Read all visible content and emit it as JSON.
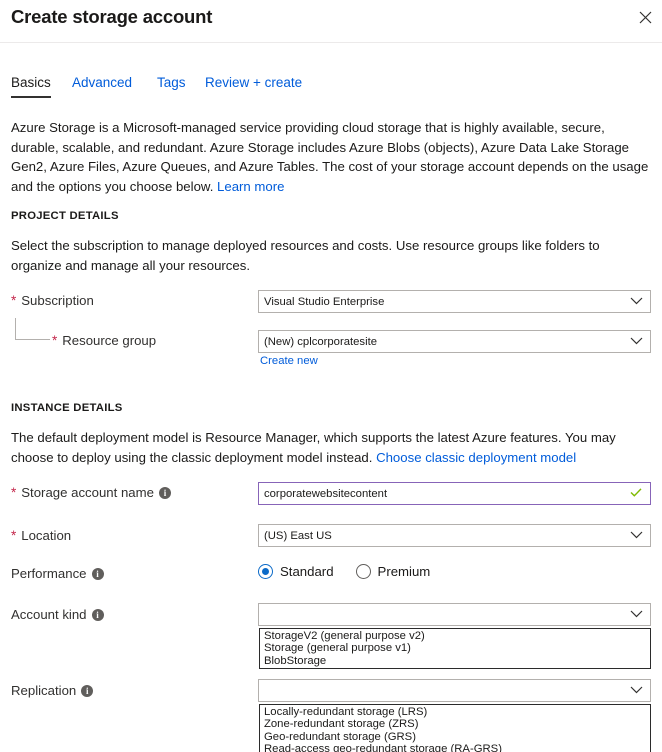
{
  "header": {
    "title": "Create storage account",
    "close_label": "✕"
  },
  "tabs": [
    {
      "label": "Basics",
      "active": true
    },
    {
      "label": "Advanced",
      "active": false
    },
    {
      "label": "Tags",
      "active": false
    },
    {
      "label": "Review + create",
      "active": false
    }
  ],
  "intro": {
    "text": "Azure Storage is a Microsoft-managed service providing cloud storage that is highly available, secure, durable, scalable, and redundant. Azure Storage includes Azure Blobs (objects), Azure Data Lake Storage Gen2, Azure Files, Azure Queues, and Azure Tables. The cost of your storage account depends on the usage and the options you choose below. ",
    "link": "Learn more"
  },
  "project_details": {
    "heading": "PROJECT DETAILS",
    "description": "Select the subscription to manage deployed resources and costs. Use resource groups like folders to organize and manage all your resources.",
    "subscription": {
      "label": "Subscription",
      "required": "*",
      "value": "Visual Studio Enterprise"
    },
    "resource_group": {
      "label": "Resource group",
      "required": "*",
      "value": "(New) cplcorporatesite",
      "create_new_link": "Create new"
    }
  },
  "instance_details": {
    "heading": "INSTANCE DETAILS",
    "description": "The default deployment model is Resource Manager, which supports the latest Azure features. You may choose to deploy using the classic deployment model instead. ",
    "description_link": "Choose classic deployment model",
    "storage_account_name": {
      "label": "Storage account name",
      "required": "*",
      "value": "corporatewebsitecontent",
      "valid": true,
      "valid_mark": "✓"
    },
    "location": {
      "label": "Location",
      "required": "*",
      "value": "(US) East US"
    },
    "performance": {
      "label": "Performance",
      "options": [
        {
          "label": "Standard",
          "selected": true
        },
        {
          "label": "Premium",
          "selected": false
        }
      ]
    },
    "account_kind": {
      "label": "Account kind",
      "value": "",
      "open": true,
      "options": [
        "StorageV2 (general purpose v2)",
        "Storage (general purpose v1)",
        "BlobStorage"
      ]
    },
    "replication": {
      "label": "Replication",
      "value": "",
      "open": true,
      "options": [
        "Locally-redundant storage (LRS)",
        "Zone-redundant storage (ZRS)",
        "Geo-redundant storage (GRS)",
        "Read-access geo-redundant storage (RA-GRS)"
      ]
    }
  },
  "colors": {
    "link": "#015cda",
    "required_asterisk": "#c4274b",
    "radio_accent": "#0b6ac8",
    "valid_border": "#8764b8",
    "valid_check": "#7fba00"
  }
}
